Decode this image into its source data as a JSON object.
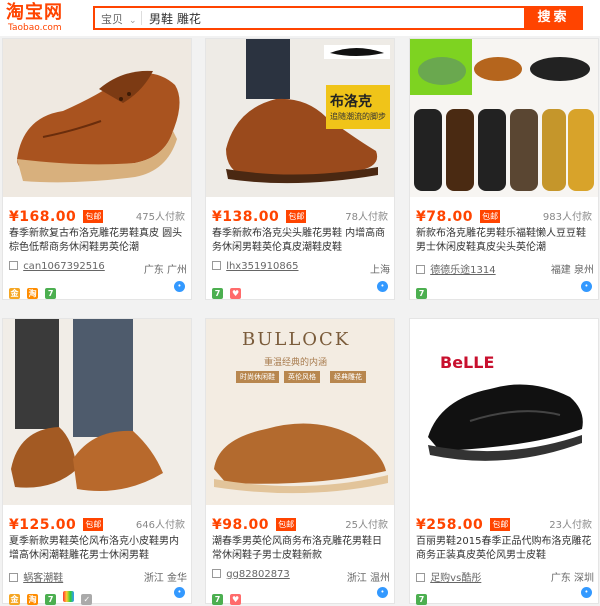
{
  "header": {
    "logo_cn": "淘宝网",
    "logo_en": "Taobao.com",
    "search_scope": "宝贝",
    "search_value": "男鞋 雕花",
    "search_button": "搜索"
  },
  "colors": {
    "accent": "#ff4400",
    "text": "#333333",
    "muted": "#888888",
    "chat": "#3399ff"
  },
  "products": [
    {
      "price": "¥168.00",
      "badge": "包邮",
      "sales": "475人付款",
      "title_parts": [
        "春季新款复古布洛克",
        "雕花男鞋",
        "真皮男鞋",
        "真皮 圆头棕色",
        "低帮商务休闲鞋",
        "男",
        "英伦潮"
      ],
      "title": "春季新款复古布洛克雕花男鞋真皮 圆头棕色低帮商务休闲鞋男英伦潮",
      "shop": "can1067392516",
      "location": "广东 广州",
      "tags": [
        "gold",
        "tmall",
        "green"
      ]
    },
    {
      "price": "¥138.00",
      "badge": "包邮",
      "sales": "78人付款",
      "title": "春季新款布洛克尖头雕花男鞋 内增高商务休闲男鞋英伦真皮潮鞋皮鞋",
      "shop": "lhx351910865",
      "location": "上海",
      "tags": [
        "green",
        "heart"
      ]
    },
    {
      "price": "¥78.00",
      "badge": "包邮",
      "sales": "983人付款",
      "title": "新款布洛克雕花男鞋乐福鞋懒人豆豆鞋男士休闲皮鞋真皮尖头英伦潮",
      "shop": "德德乐途1314",
      "location": "福建 泉州",
      "tags": [
        "green"
      ]
    },
    {
      "price": "¥125.00",
      "badge": "包邮",
      "sales": "646人付款",
      "title": "夏季新款男鞋英伦风布洛克小皮鞋男内增高休闲潮鞋雕花男士休闲男鞋",
      "shop": "蜗客潮鞋",
      "location": "浙江 金华",
      "tags": [
        "gold",
        "tmall",
        "green",
        "color",
        "shield"
      ]
    },
    {
      "price": "¥98.00",
      "badge": "包邮",
      "sales": "25人付款",
      "title": "潮春季男英伦风商务布洛克雕花男鞋日常休闲鞋子男士皮鞋新款",
      "shop": "gg82802873",
      "location": "浙江 温州",
      "tags": [
        "green",
        "heart"
      ]
    },
    {
      "price": "¥258.00",
      "badge": "包邮",
      "sales": "23人付款",
      "title": "百丽男鞋2015春季正品代购布洛克雕花商务正装真皮英伦风男士皮鞋",
      "shop": "足购vs酷彤",
      "location": "广东 深圳",
      "tags": [
        "green"
      ],
      "brand": "BeLLE"
    }
  ],
  "image_text": {
    "p2_label": "布洛克",
    "p2_sub": "追随潮流的脚步",
    "p5_brand": "BULLOCK",
    "p5_sub": "重温经典的内涵",
    "p5_tag1": "时尚休闲鞋",
    "p5_tag2": "英伦风格",
    "p5_tag3": "经典雕花"
  }
}
